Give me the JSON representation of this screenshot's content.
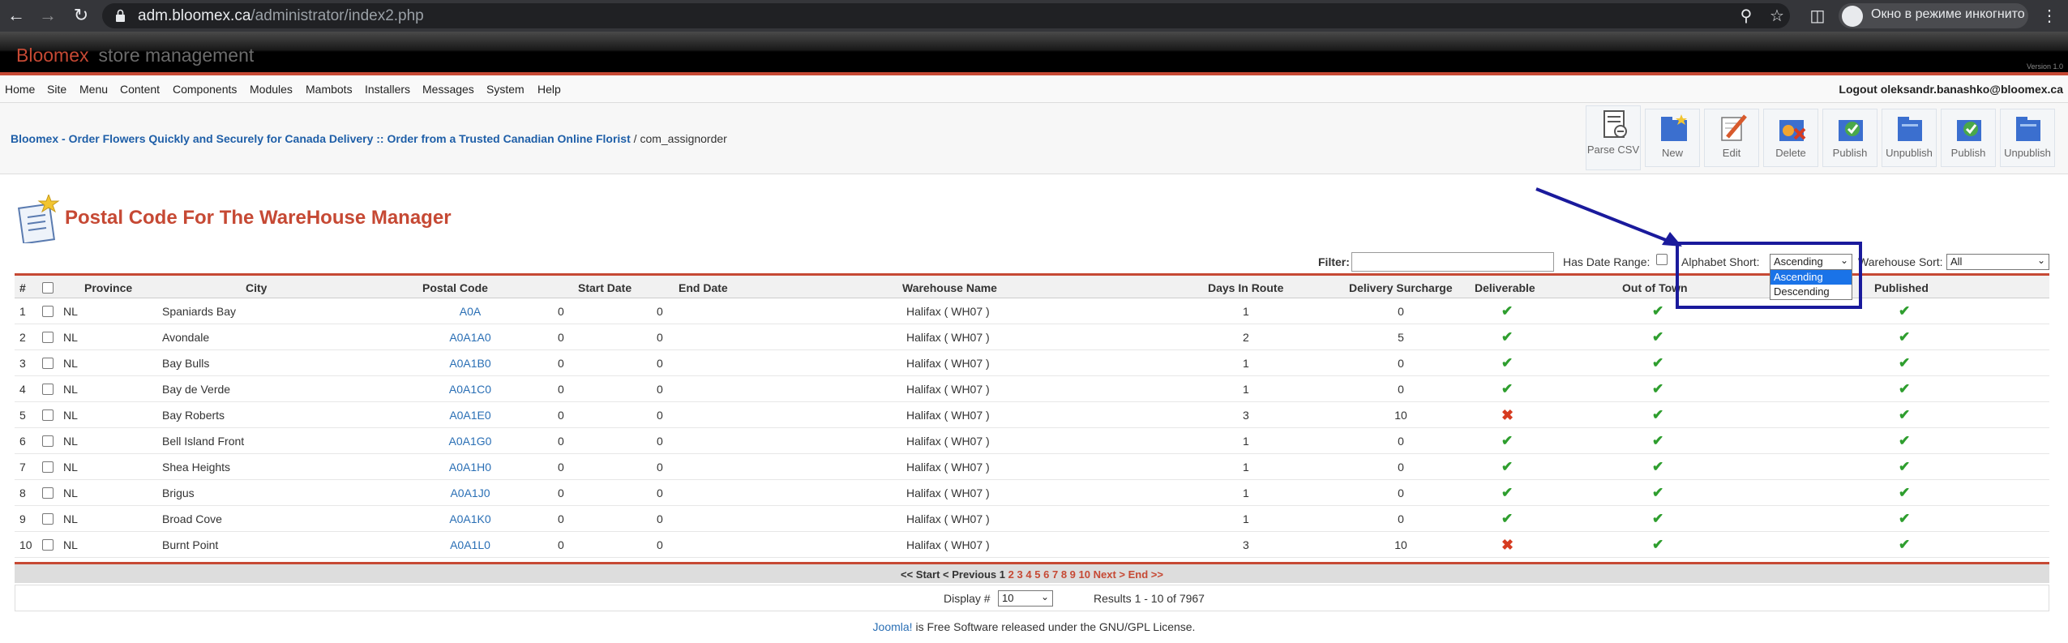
{
  "browser": {
    "url_host": "adm.bloomex.ca",
    "url_path": "/administrator/index2.php",
    "incognito_label": "Окно в режиме инкогнито"
  },
  "banner": {
    "brand": "Bloomex",
    "brand2": "store management",
    "version": "Version 1.0"
  },
  "menu": [
    "Home",
    "Site",
    "Menu",
    "Content",
    "Components",
    "Modules",
    "Mambots",
    "Installers",
    "Messages",
    "System",
    "Help"
  ],
  "logout": "Logout oleksandr.banashko@bloomex.ca",
  "breadcrumb": {
    "link": "Bloomex - Order Flowers Quickly and Securely for Canada Delivery :: Order from a Trusted Canadian Online Florist",
    "sep": " / ",
    "current": "com_assignorder"
  },
  "toolbar": [
    {
      "label": "Parse CSV",
      "icon": "parse-csv-icon"
    },
    {
      "label": "New",
      "icon": "new-folder-icon"
    },
    {
      "label": "Edit",
      "icon": "edit-icon"
    },
    {
      "label": "Delete",
      "icon": "delete-icon"
    },
    {
      "label": "Publish",
      "icon": "publish-icon"
    },
    {
      "label": "Unpublish",
      "icon": "unpublish-icon"
    },
    {
      "label": "Publish",
      "icon": "publish-icon"
    },
    {
      "label": "Unpublish",
      "icon": "unpublish-icon"
    }
  ],
  "page_title": "Postal Code For The WareHouse Manager",
  "filters": {
    "filter_label": "Filter:",
    "filter_value": "",
    "date_range_label": "Has Date Range:",
    "alpha_label": "Alphabet Short:",
    "alpha_value": "Ascending",
    "alpha_options": [
      "Ascending",
      "Descending"
    ],
    "wh_label": "Warehouse Sort:",
    "wh_value": "All"
  },
  "columns": [
    "#",
    "",
    "Province",
    "City",
    "Postal Code",
    "Start Date",
    "End Date",
    "Warehouse Name",
    "Days In Route",
    "Delivery Surcharge",
    "Deliverable",
    "Out of Town",
    "Published"
  ],
  "rows": [
    {
      "n": "1",
      "prov": "NL",
      "city": "Spaniards Bay",
      "pc": "A0A",
      "sd": "0",
      "ed": "0",
      "wh": "Halifax ( WH07 )",
      "days": "1",
      "sur": "0",
      "del": true,
      "oot": true,
      "pub": true
    },
    {
      "n": "2",
      "prov": "NL",
      "city": "Avondale",
      "pc": "A0A1A0",
      "sd": "0",
      "ed": "0",
      "wh": "Halifax ( WH07 )",
      "days": "2",
      "sur": "5",
      "del": true,
      "oot": true,
      "pub": true
    },
    {
      "n": "3",
      "prov": "NL",
      "city": "Bay Bulls",
      "pc": "A0A1B0",
      "sd": "0",
      "ed": "0",
      "wh": "Halifax ( WH07 )",
      "days": "1",
      "sur": "0",
      "del": true,
      "oot": true,
      "pub": true
    },
    {
      "n": "4",
      "prov": "NL",
      "city": "Bay de Verde",
      "pc": "A0A1C0",
      "sd": "0",
      "ed": "0",
      "wh": "Halifax ( WH07 )",
      "days": "1",
      "sur": "0",
      "del": true,
      "oot": true,
      "pub": true
    },
    {
      "n": "5",
      "prov": "NL",
      "city": "Bay Roberts",
      "pc": "A0A1E0",
      "sd": "0",
      "ed": "0",
      "wh": "Halifax ( WH07 )",
      "days": "3",
      "sur": "10",
      "del": false,
      "oot": true,
      "pub": true
    },
    {
      "n": "6",
      "prov": "NL",
      "city": "Bell Island Front",
      "pc": "A0A1G0",
      "sd": "0",
      "ed": "0",
      "wh": "Halifax ( WH07 )",
      "days": "1",
      "sur": "0",
      "del": true,
      "oot": true,
      "pub": true
    },
    {
      "n": "7",
      "prov": "NL",
      "city": "Shea Heights",
      "pc": "A0A1H0",
      "sd": "0",
      "ed": "0",
      "wh": "Halifax ( WH07 )",
      "days": "1",
      "sur": "0",
      "del": true,
      "oot": true,
      "pub": true
    },
    {
      "n": "8",
      "prov": "NL",
      "city": "Brigus",
      "pc": "A0A1J0",
      "sd": "0",
      "ed": "0",
      "wh": "Halifax ( WH07 )",
      "days": "1",
      "sur": "0",
      "del": true,
      "oot": true,
      "pub": true
    },
    {
      "n": "9",
      "prov": "NL",
      "city": "Broad Cove",
      "pc": "A0A1K0",
      "sd": "0",
      "ed": "0",
      "wh": "Halifax ( WH07 )",
      "days": "1",
      "sur": "0",
      "del": true,
      "oot": true,
      "pub": true
    },
    {
      "n": "10",
      "prov": "NL",
      "city": "Burnt Point",
      "pc": "A0A1L0",
      "sd": "0",
      "ed": "0",
      "wh": "Halifax ( WH07 )",
      "days": "3",
      "sur": "10",
      "del": false,
      "oot": true,
      "pub": true
    }
  ],
  "pagination": {
    "start": "<< Start",
    "prev": "< Previous",
    "current": "1",
    "pages": [
      "2",
      "3",
      "4",
      "5",
      "6",
      "7",
      "8",
      "9",
      "10"
    ],
    "next": "Next >",
    "end": "End >>"
  },
  "display": {
    "label": "Display #",
    "value": "10",
    "results": "Results 1 - 10 of 7967"
  },
  "license": {
    "link": "Joomla!",
    "text": " is Free Software released under the GNU/GPL License."
  },
  "colors": {
    "accent": "#c64934",
    "link": "#2a6fb5",
    "highlight": "#1a1a9c",
    "check": "#2e9e2e",
    "cross": "#d63b20"
  }
}
